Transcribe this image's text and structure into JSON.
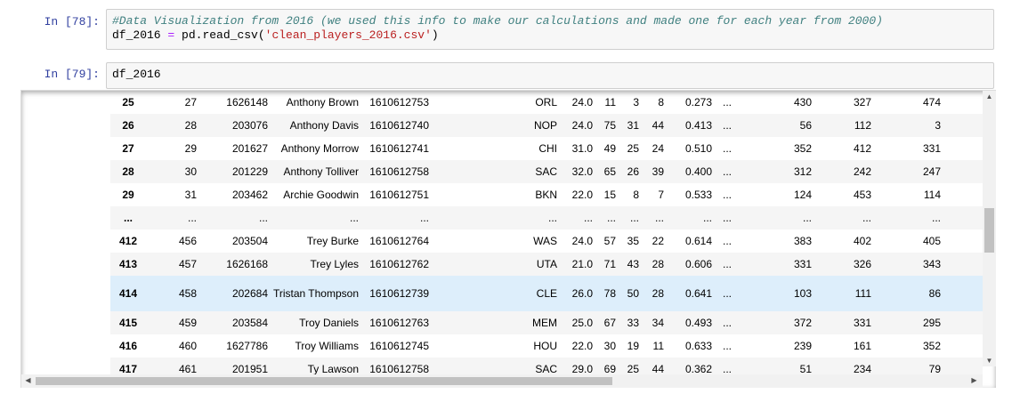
{
  "cells": [
    {
      "prompt": "In [78]:",
      "lines": [
        [
          {
            "t": "#Data Visualization from 2016 (we used this info to make our calculations and made one for each year from 2000)",
            "k": "comment"
          }
        ],
        [
          {
            "t": "df_2016 ",
            "k": "plain"
          },
          {
            "t": "=",
            "k": "op"
          },
          {
            "t": " pd.read_csv(",
            "k": "plain"
          },
          {
            "t": "'clean_players_2016.csv'",
            "k": "string"
          },
          {
            "t": ")",
            "k": "plain"
          }
        ]
      ]
    },
    {
      "prompt": "In [79]:",
      "lines": [
        [
          {
            "t": "df_2016",
            "k": "plain"
          }
        ]
      ]
    }
  ],
  "table": {
    "rows": [
      {
        "idx": "25",
        "c1": "27",
        "c2": "1626148",
        "name": "Anthony Brown",
        "team_id": "1610612753",
        "team": "ORL",
        "age": "24.0",
        "gp": "11",
        "w": "3",
        "l": "8",
        "pct": "0.273",
        "e": "...",
        "a": "430",
        "b": "327",
        "c": "474"
      },
      {
        "idx": "26",
        "c1": "28",
        "c2": "203076",
        "name": "Anthony Davis",
        "team_id": "1610612740",
        "team": "NOP",
        "age": "24.0",
        "gp": "75",
        "w": "31",
        "l": "44",
        "pct": "0.413",
        "e": "...",
        "a": "56",
        "b": "112",
        "c": "3"
      },
      {
        "idx": "27",
        "c1": "29",
        "c2": "201627",
        "name": "Anthony Morrow",
        "team_id": "1610612741",
        "team": "CHI",
        "age": "31.0",
        "gp": "49",
        "w": "25",
        "l": "24",
        "pct": "0.510",
        "e": "...",
        "a": "352",
        "b": "412",
        "c": "331"
      },
      {
        "idx": "28",
        "c1": "30",
        "c2": "201229",
        "name": "Anthony Tolliver",
        "team_id": "1610612758",
        "team": "SAC",
        "age": "32.0",
        "gp": "65",
        "w": "26",
        "l": "39",
        "pct": "0.400",
        "e": "...",
        "a": "312",
        "b": "242",
        "c": "247"
      },
      {
        "idx": "29",
        "c1": "31",
        "c2": "203462",
        "name": "Archie Goodwin",
        "team_id": "1610612751",
        "team": "BKN",
        "age": "22.0",
        "gp": "15",
        "w": "8",
        "l": "7",
        "pct": "0.533",
        "e": "...",
        "a": "124",
        "b": "453",
        "c": "114"
      },
      {
        "idx": "...",
        "c1": "...",
        "c2": "...",
        "name": "...",
        "team_id": "...",
        "team": "...",
        "age": "...",
        "gp": "...",
        "w": "...",
        "l": "...",
        "pct": "...",
        "e": "...",
        "a": "...",
        "b": "...",
        "c": "..."
      },
      {
        "idx": "412",
        "c1": "456",
        "c2": "203504",
        "name": "Trey Burke",
        "team_id": "1610612764",
        "team": "WAS",
        "age": "24.0",
        "gp": "57",
        "w": "35",
        "l": "22",
        "pct": "0.614",
        "e": "...",
        "a": "383",
        "b": "402",
        "c": "405"
      },
      {
        "idx": "413",
        "c1": "457",
        "c2": "1626168",
        "name": "Trey Lyles",
        "team_id": "1610612762",
        "team": "UTA",
        "age": "21.0",
        "gp": "71",
        "w": "43",
        "l": "28",
        "pct": "0.606",
        "e": "...",
        "a": "331",
        "b": "326",
        "c": "343"
      },
      {
        "idx": "414",
        "c1": "458",
        "c2": "202684",
        "name": "Tristan Thompson",
        "team_id": "1610612739",
        "team": "CLE",
        "age": "26.0",
        "gp": "78",
        "w": "50",
        "l": "28",
        "pct": "0.641",
        "e": "...",
        "a": "103",
        "b": "111",
        "c": "86"
      },
      {
        "idx": "415",
        "c1": "459",
        "c2": "203584",
        "name": "Troy Daniels",
        "team_id": "1610612763",
        "team": "MEM",
        "age": "25.0",
        "gp": "67",
        "w": "33",
        "l": "34",
        "pct": "0.493",
        "e": "...",
        "a": "372",
        "b": "331",
        "c": "295"
      },
      {
        "idx": "416",
        "c1": "460",
        "c2": "1627786",
        "name": "Troy Williams",
        "team_id": "1610612745",
        "team": "HOU",
        "age": "22.0",
        "gp": "30",
        "w": "19",
        "l": "11",
        "pct": "0.633",
        "e": "...",
        "a": "239",
        "b": "161",
        "c": "352"
      },
      {
        "idx": "417",
        "c1": "461",
        "c2": "201951",
        "name": "Ty Lawson",
        "team_id": "1610612758",
        "team": "SAC",
        "age": "29.0",
        "gp": "69",
        "w": "25",
        "l": "44",
        "pct": "0.362",
        "e": "...",
        "a": "51",
        "b": "234",
        "c": "79"
      }
    ],
    "highlighted_row": "414"
  },
  "scrollbars": {
    "up_arrow": "▲",
    "down_arrow": "▼",
    "left_arrow": "◀",
    "right_arrow": "▶"
  },
  "colors": {
    "prompt": "#303f9f",
    "comment": "#408080",
    "string": "#ba2121",
    "operator": "#aa22ff",
    "highlight": "#ddeefb"
  }
}
